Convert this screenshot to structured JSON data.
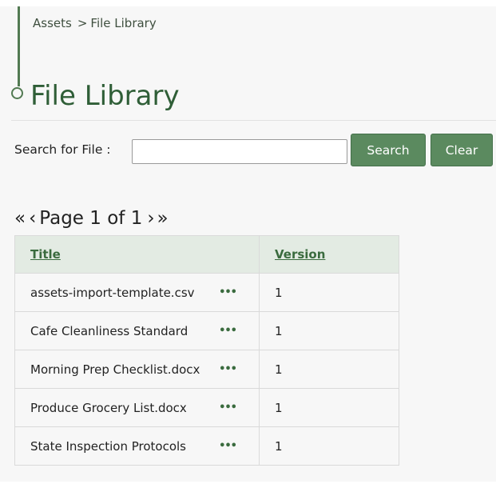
{
  "breadcrumb": {
    "parent": "Assets",
    "separator": ">",
    "current": "File Library"
  },
  "page": {
    "title": "File Library"
  },
  "search": {
    "label": "Search for File :",
    "value": "",
    "placeholder": "",
    "search_button": "Search",
    "clear_button": "Clear"
  },
  "pagination": {
    "first": "«",
    "prev": "‹",
    "label": "Page 1 of 1",
    "next": "›",
    "last": "»"
  },
  "table": {
    "headers": {
      "title": "Title",
      "version": "Version"
    },
    "rows": [
      {
        "title": "assets-import-template.csv",
        "actions": "•••",
        "version": "1"
      },
      {
        "title": "Cafe Cleanliness Standard",
        "actions": "•••",
        "version": "1"
      },
      {
        "title": "Morning Prep Checklist.docx",
        "actions": "•••",
        "version": "1"
      },
      {
        "title": "Produce Grocery List.docx",
        "actions": "•••",
        "version": "1"
      },
      {
        "title": "State Inspection Protocols",
        "actions": "•••",
        "version": "1"
      }
    ]
  },
  "colors": {
    "accent": "#2f5e37",
    "button": "#5b8a5f",
    "header_bg": "#e3ebe3",
    "panel_bg": "#f7f7f7"
  },
  "icons": {
    "timeline": "timeline-node-icon",
    "row_actions": "more-actions-icon"
  }
}
